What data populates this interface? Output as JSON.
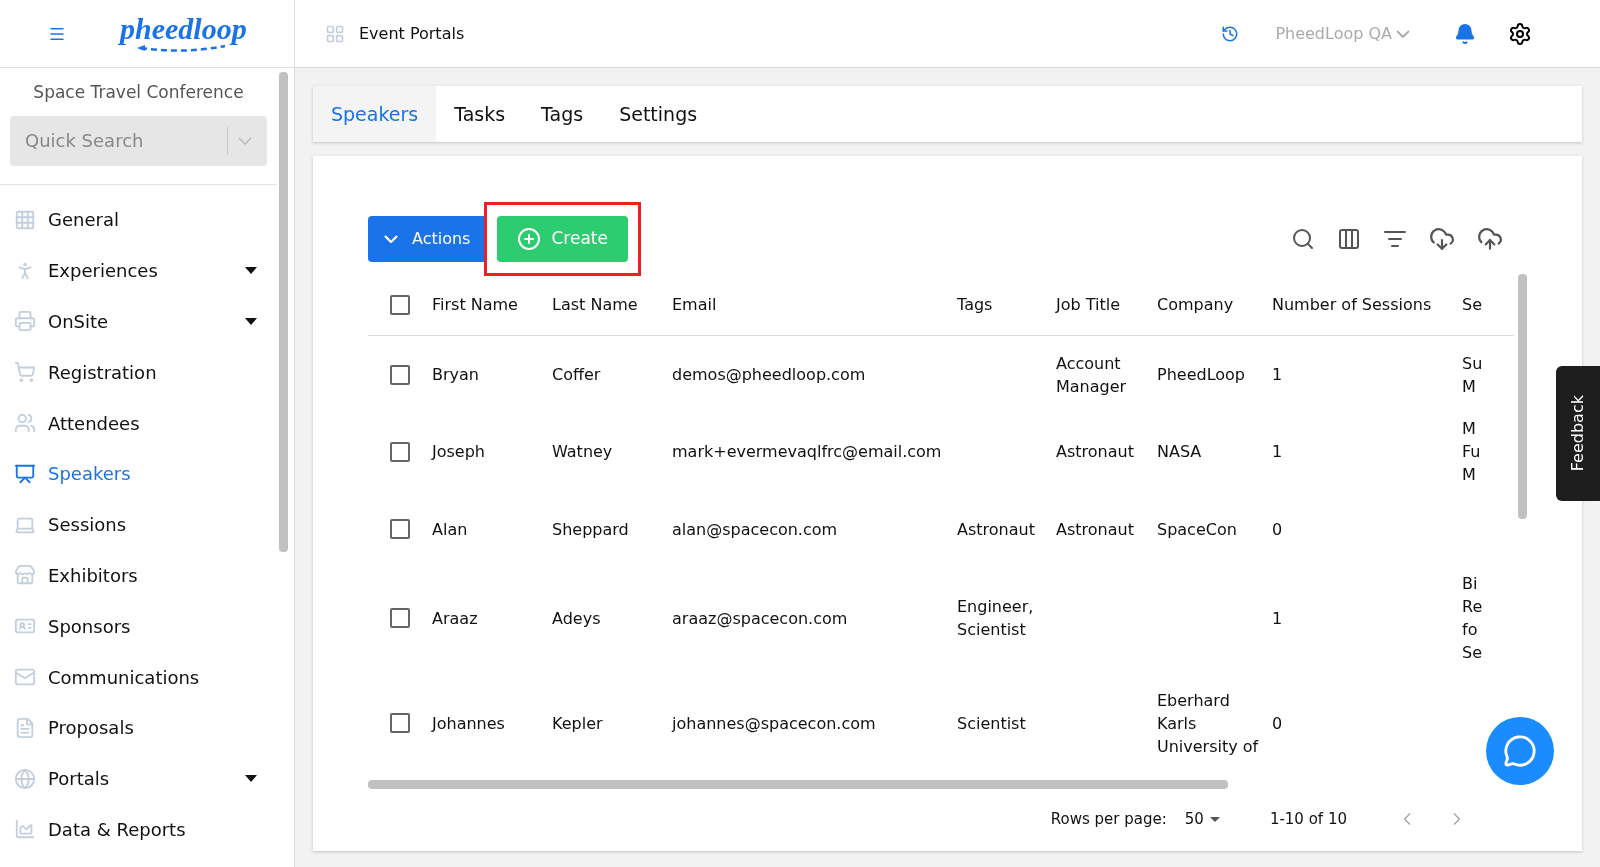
{
  "header": {
    "logo": "pheedloop",
    "section": "Event Portals",
    "account": "PheedLoop QA"
  },
  "sidebar": {
    "event": "Space Travel Conference",
    "search": {
      "placeholder": "Quick Search"
    },
    "items": [
      {
        "label": "General",
        "expandable": false,
        "selected": false
      },
      {
        "label": "Experiences",
        "expandable": true,
        "selected": false
      },
      {
        "label": "OnSite",
        "expandable": true,
        "selected": false
      },
      {
        "label": "Registration",
        "expandable": false,
        "selected": false
      },
      {
        "label": "Attendees",
        "expandable": false,
        "selected": false
      },
      {
        "label": "Speakers",
        "expandable": false,
        "selected": true
      },
      {
        "label": "Sessions",
        "expandable": false,
        "selected": false
      },
      {
        "label": "Exhibitors",
        "expandable": false,
        "selected": false
      },
      {
        "label": "Sponsors",
        "expandable": false,
        "selected": false
      },
      {
        "label": "Communications",
        "expandable": false,
        "selected": false
      },
      {
        "label": "Proposals",
        "expandable": false,
        "selected": false
      },
      {
        "label": "Portals",
        "expandable": true,
        "selected": false
      },
      {
        "label": "Data & Reports",
        "expandable": false,
        "selected": false
      }
    ]
  },
  "tabs": [
    {
      "label": "Speakers",
      "selected": true
    },
    {
      "label": "Tasks",
      "selected": false
    },
    {
      "label": "Tags",
      "selected": false
    },
    {
      "label": "Settings",
      "selected": false
    }
  ],
  "toolbar": {
    "actions": "Actions",
    "create": "Create"
  },
  "table": {
    "all_checked": false,
    "columns": [
      "First Name",
      "Last Name",
      "Email",
      "Tags",
      "Job Title",
      "Company",
      "Number of Sessions",
      "Se"
    ],
    "rows": [
      {
        "checked": false,
        "cells": [
          [
            "Bryan"
          ],
          [
            "Coffer"
          ],
          [
            "demos@pheedloop.com"
          ],
          [],
          [
            "Account",
            "Manager"
          ],
          [
            "PheedLoop"
          ],
          [
            "1"
          ],
          [
            "Su",
            "M"
          ]
        ]
      },
      {
        "checked": false,
        "cells": [
          [
            "Joseph"
          ],
          [
            "Watney"
          ],
          [
            "mark+evermevaqlfrc@email.com"
          ],
          [],
          [
            "Astronaut"
          ],
          [
            "NASA"
          ],
          [
            "1"
          ],
          [
            "M",
            "Fu",
            "M"
          ]
        ]
      },
      {
        "checked": false,
        "cells": [
          [
            "Alan"
          ],
          [
            "Sheppard"
          ],
          [
            "alan@spacecon.com"
          ],
          [
            "Astronaut"
          ],
          [
            "Astronaut"
          ],
          [
            "SpaceCon"
          ],
          [
            "0"
          ],
          []
        ]
      },
      {
        "checked": false,
        "cells": [
          [
            "Araaz"
          ],
          [
            "Adeys"
          ],
          [
            "araaz@spacecon.com"
          ],
          [
            "Engineer,",
            "Scientist"
          ],
          [],
          [],
          [
            "1"
          ],
          [
            "Bi",
            "Re",
            "fo",
            "Se"
          ]
        ]
      },
      {
        "checked": false,
        "cells": [
          [
            "Johannes"
          ],
          [
            "Kepler"
          ],
          [
            "johannes@spacecon.com"
          ],
          [
            "Scientist"
          ],
          [],
          [
            "Eberhard",
            "Karls",
            "University of"
          ],
          [
            "0"
          ],
          []
        ]
      }
    ]
  },
  "pagination": {
    "rows_label": "Rows per page:",
    "rows_value": "50",
    "range": "1-10 of 10"
  },
  "feedback": "Feedback"
}
